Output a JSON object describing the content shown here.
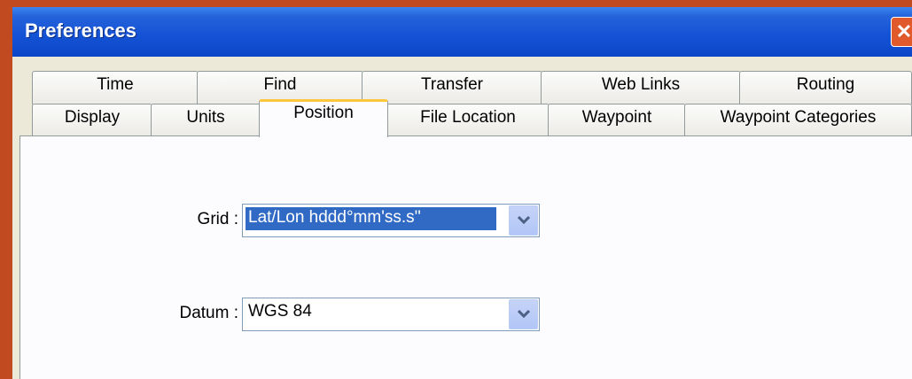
{
  "window": {
    "title": "Preferences"
  },
  "tabs_back": [
    "Time",
    "Find",
    "Transfer",
    "Web Links",
    "Routing"
  ],
  "tabs_front": [
    "Display",
    "Units",
    "Position",
    "File Location",
    "Waypoint",
    "Waypoint Categories"
  ],
  "active_tab": "Position",
  "grid": {
    "label": "Grid :",
    "value": "Lat/Lon hddd°mm'ss.s''"
  },
  "datum": {
    "label": "Datum :",
    "value": "WGS 84"
  },
  "colors": {
    "title_bar": "#1553d6",
    "frame": "#c24a21",
    "selection": "#316ac5",
    "active_tab_accent": "#ffc83c"
  }
}
